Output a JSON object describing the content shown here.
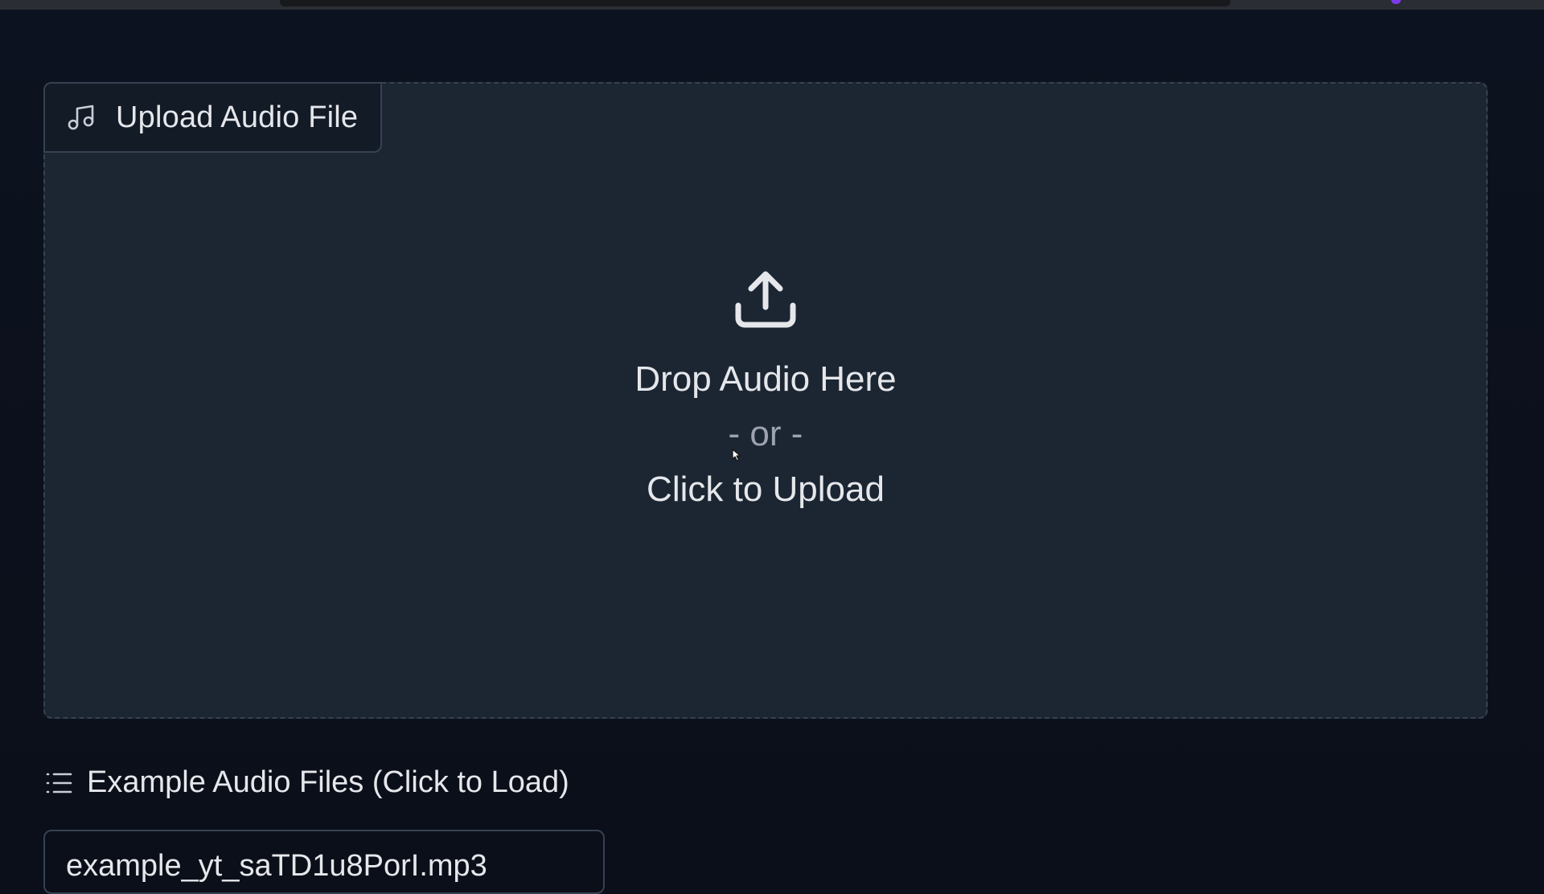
{
  "upload": {
    "label": "Upload Audio File",
    "label_icon": "music-note-icon",
    "drop_icon": "upload-icon",
    "drop_text": "Drop Audio Here",
    "or_text": "- or -",
    "click_text": "Click to Upload"
  },
  "examples": {
    "title": "Example Audio Files (Click to Load)",
    "title_icon": "list-icon",
    "items": [
      {
        "label": "example_yt_saTD1u8PorI.mp3"
      }
    ]
  },
  "colors": {
    "background": "#0b0f19",
    "panel": "#1c2633",
    "border": "#364152",
    "text": "#e5e7eb",
    "muted_text": "#9ca3af"
  }
}
